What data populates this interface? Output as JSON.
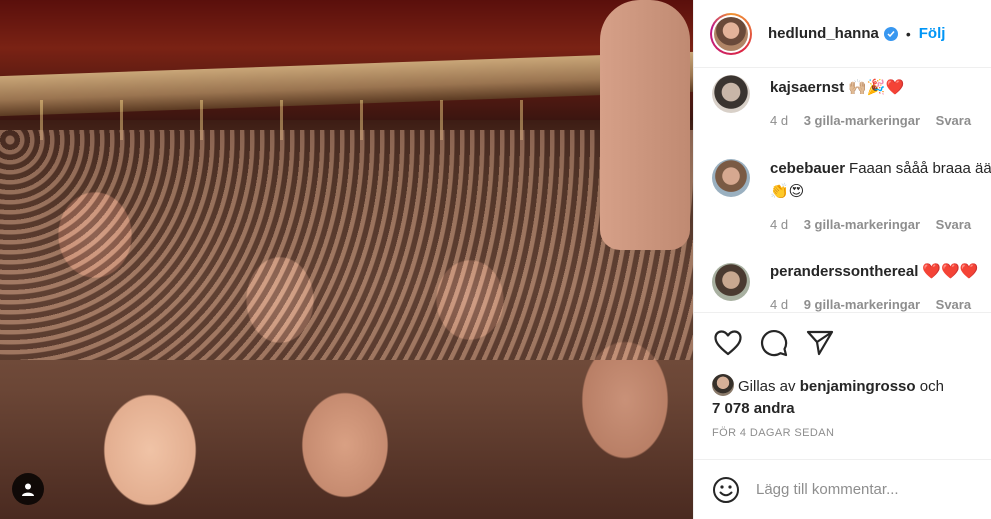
{
  "post": {
    "username": "hedlund_hanna",
    "verified": true,
    "follow_label": "Följ",
    "separator": "•"
  },
  "comments": [
    {
      "username": "kajsaernst",
      "text": "🙌🏼🎉❤️",
      "time": "4 d",
      "likes": "3 gilla-markeringar",
      "reply": "Svara"
    },
    {
      "username": "cebebauer",
      "text": "Faaan sååå braaa ääär👏😍",
      "time": "4 d",
      "likes": "3 gilla-markeringar",
      "reply": "Svara"
    },
    {
      "username": "peranderssonthereal",
      "text": "❤️❤️❤️",
      "time": "4 d",
      "likes": "9 gilla-markeringar",
      "reply": "Svara"
    }
  ],
  "likes": {
    "prefix": "Gillas av",
    "user": "benjamingrosso",
    "connector": "och",
    "others": "7 078 andra"
  },
  "timestamp": "FÖR 4 DAGAR SEDAN",
  "comment_input": {
    "placeholder": "Lägg till kommentar..."
  },
  "icons": {
    "like": "heart-icon",
    "comment": "comment-bubble-icon",
    "share": "paper-plane-icon",
    "emoji": "smiley-icon",
    "tag": "user-tag-icon",
    "verified": "verified-badge-icon"
  },
  "colors": {
    "accent": "#0095f6",
    "verified": "#3897f0",
    "muted": "#8e8e8e",
    "text": "#262626"
  }
}
